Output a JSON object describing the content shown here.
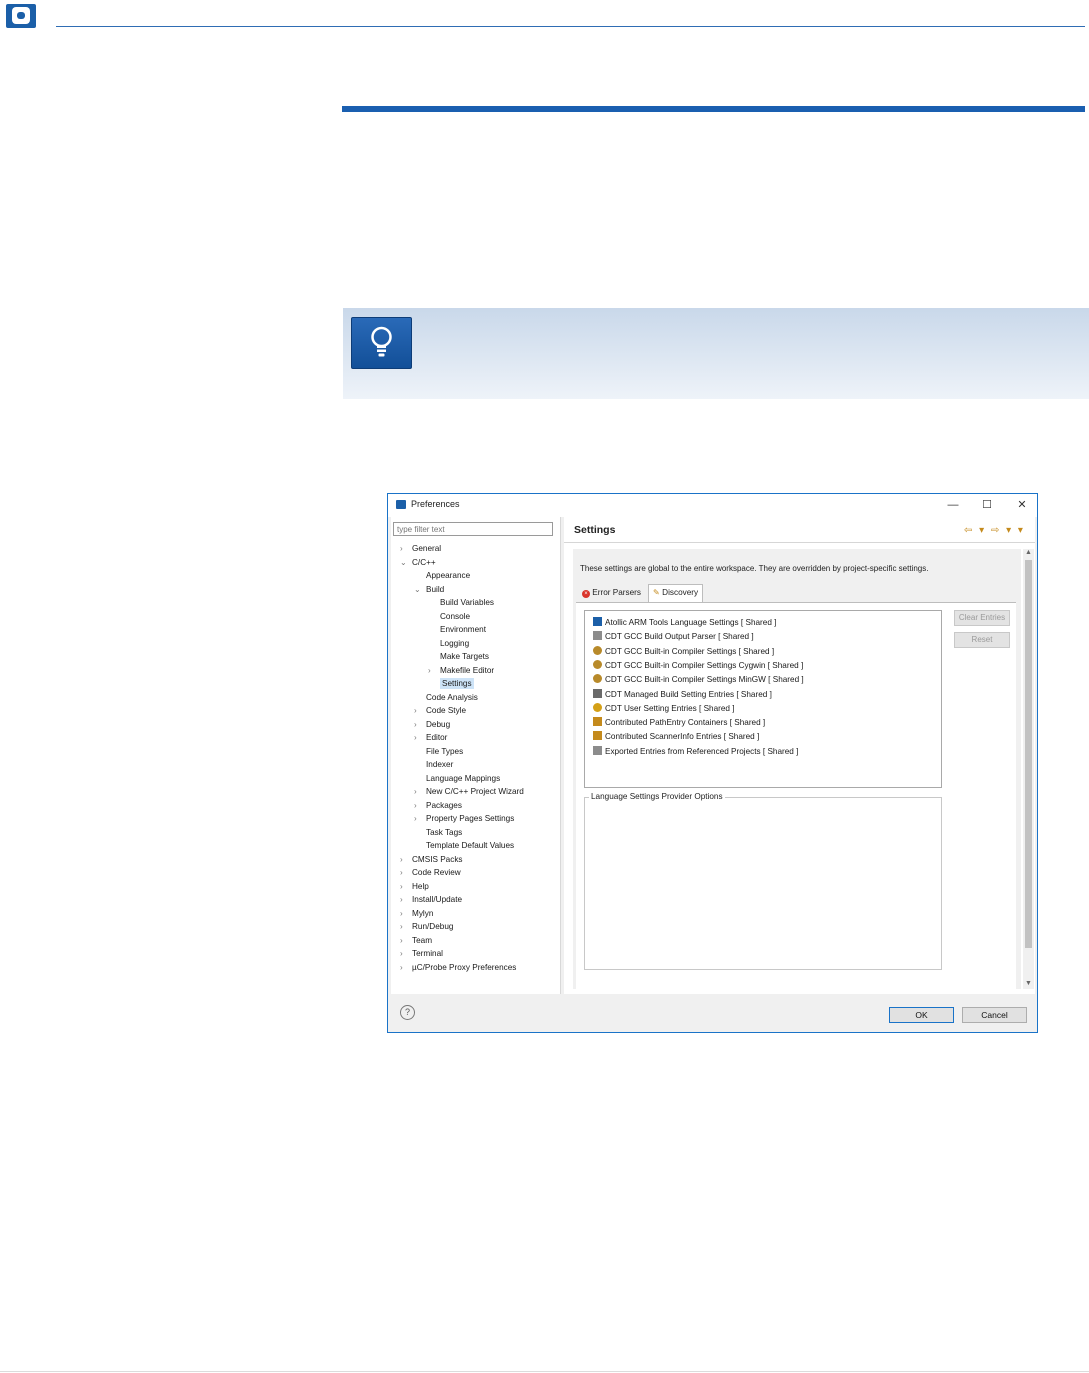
{
  "colors": {
    "brand": "#1b5fa8",
    "rule": "#1a5fb0",
    "dialog_border": "#1a73c8",
    "tip_bg_top": "#c9d8ea",
    "selection": "#cde3f7"
  },
  "header": {
    "logo_icon": "atollic-logo-icon"
  },
  "tip": {
    "icon": "lightbulb-icon"
  },
  "dialog": {
    "title": "Preferences",
    "window_buttons": {
      "minimize": "—",
      "maximize": "☐",
      "close": "✕"
    },
    "filter_placeholder": "type filter text",
    "tree": [
      {
        "label": "General",
        "arrow": ">"
      },
      {
        "label": "C/C++",
        "arrow": "v"
      },
      {
        "label": "Appearance",
        "arrow": ""
      },
      {
        "label": "Build",
        "arrow": "v"
      },
      {
        "label": "Build Variables",
        "arrow": ""
      },
      {
        "label": "Console",
        "arrow": ""
      },
      {
        "label": "Environment",
        "arrow": ""
      },
      {
        "label": "Logging",
        "arrow": ""
      },
      {
        "label": "Make Targets",
        "arrow": ""
      },
      {
        "label": "Makefile Editor",
        "arrow": ">"
      },
      {
        "label": "Settings",
        "arrow": ""
      },
      {
        "label": "Code Analysis",
        "arrow": ""
      },
      {
        "label": "Code Style",
        "arrow": ">"
      },
      {
        "label": "Debug",
        "arrow": ">"
      },
      {
        "label": "Editor",
        "arrow": ">"
      },
      {
        "label": "File Types",
        "arrow": ""
      },
      {
        "label": "Indexer",
        "arrow": ""
      },
      {
        "label": "Language Mappings",
        "arrow": ""
      },
      {
        "label": "New C/C++ Project Wizard",
        "arrow": ">"
      },
      {
        "label": "Packages",
        "arrow": ">"
      },
      {
        "label": "Property Pages Settings",
        "arrow": ">"
      },
      {
        "label": "Task Tags",
        "arrow": ""
      },
      {
        "label": "Template Default Values",
        "arrow": ""
      },
      {
        "label": "CMSIS Packs",
        "arrow": ">"
      },
      {
        "label": "Code Review",
        "arrow": ">"
      },
      {
        "label": "Help",
        "arrow": ">"
      },
      {
        "label": "Install/Update",
        "arrow": ">"
      },
      {
        "label": "Mylyn",
        "arrow": ">"
      },
      {
        "label": "Run/Debug",
        "arrow": ">"
      },
      {
        "label": "Team",
        "arrow": ">"
      },
      {
        "label": "Terminal",
        "arrow": ">"
      },
      {
        "label": "µC/Probe Proxy Preferences",
        "arrow": ">"
      }
    ],
    "selected_item": "Settings",
    "page_title": "Settings",
    "nav": "⇦ ▾ ⇨ ▾ ▾",
    "description": "These settings are global to the entire workspace.  They are overridden by project-specific settings.",
    "tabs": {
      "error_parsers": "Error Parsers",
      "discovery": "Discovery"
    },
    "providers": [
      {
        "label": "Atollic ARM Tools Language Settings   [ Shared ]",
        "icon": "atollic-icon"
      },
      {
        "label": "CDT GCC Build Output Parser   [ Shared ]",
        "icon": "document-icon"
      },
      {
        "label": "CDT GCC Built-in Compiler Settings   [ Shared ]",
        "icon": "magnifier-icon"
      },
      {
        "label": "CDT GCC Built-in Compiler Settings Cygwin   [ Shared ]",
        "icon": "magnifier-icon"
      },
      {
        "label": "CDT GCC Built-in Compiler Settings MinGW   [ Shared ]",
        "icon": "magnifier-icon"
      },
      {
        "label": "CDT Managed Build Setting Entries   [ Shared ]",
        "icon": "build-icon"
      },
      {
        "label": "CDT User Setting Entries   [ Shared ]",
        "icon": "user-icon"
      },
      {
        "label": "Contributed PathEntry Containers   [ Shared ]",
        "icon": "key-icon"
      },
      {
        "label": "Contributed ScannerInfo Entries   [ Shared ]",
        "icon": "key-icon"
      },
      {
        "label": "Exported Entries from Referenced Projects   [ Shared ]",
        "icon": "document-icon"
      }
    ],
    "clear_entries": "Clear Entries",
    "reset": "Reset",
    "options_group": "Language Settings Provider Options",
    "help": "?",
    "ok": "OK",
    "cancel": "Cancel"
  }
}
